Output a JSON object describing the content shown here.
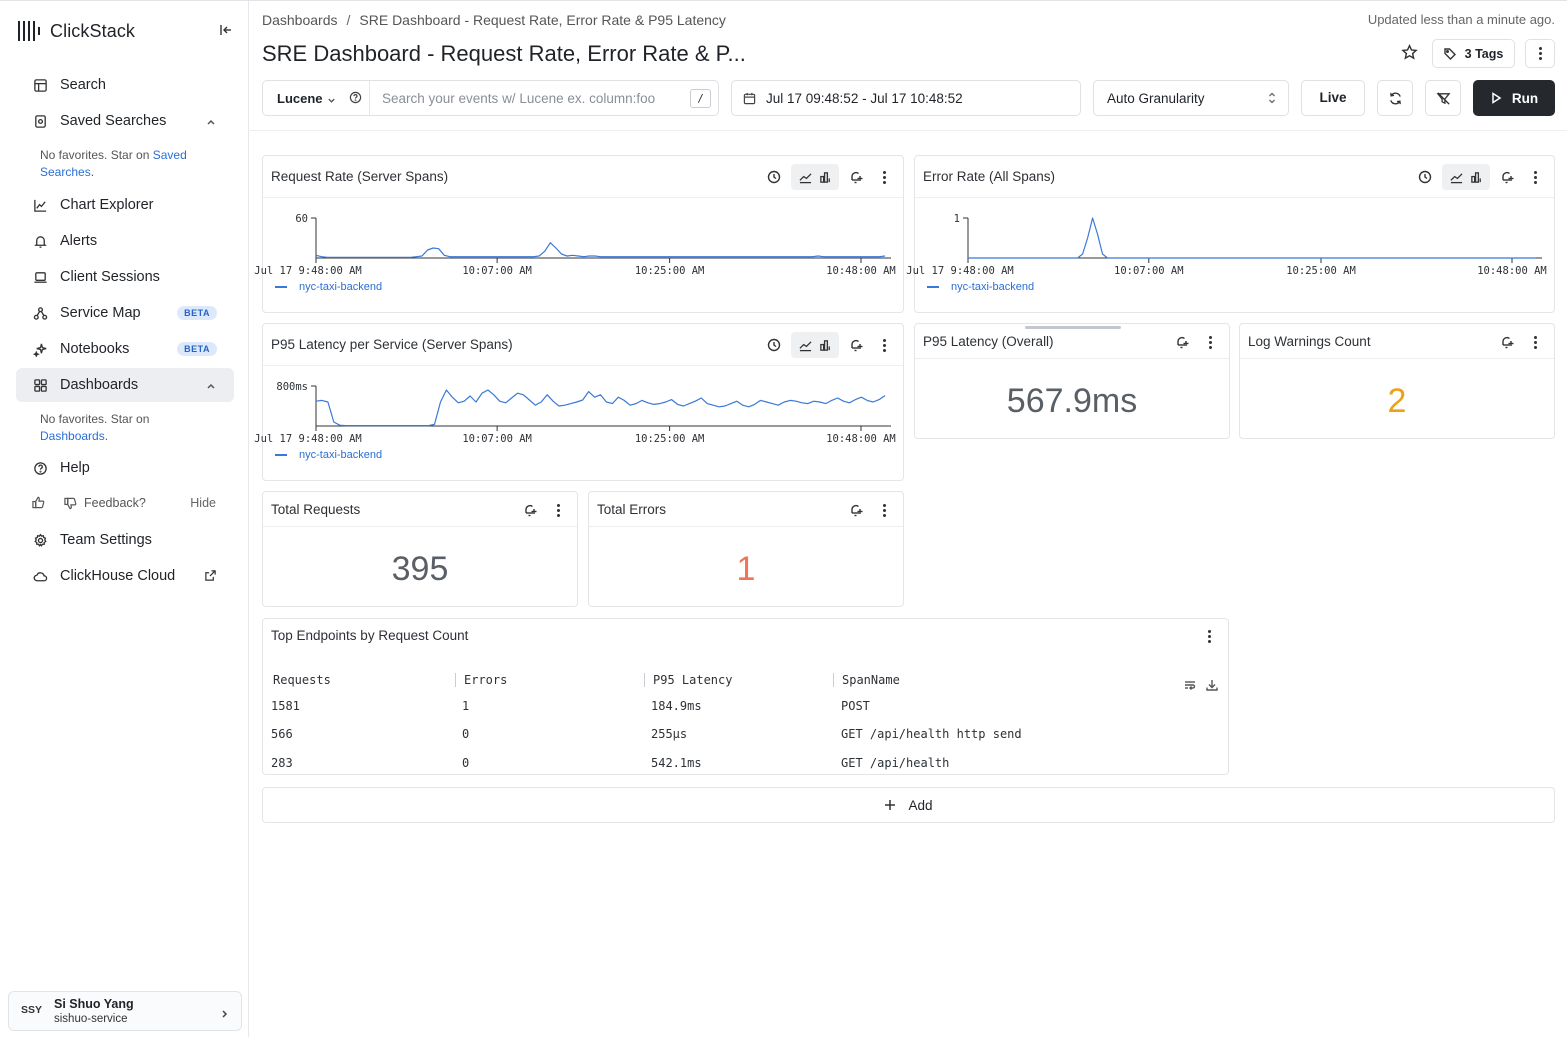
{
  "sidebar": {
    "brand": "ClickStack",
    "items": {
      "search": "Search",
      "saved_searches": "Saved Searches",
      "chart_explorer": "Chart Explorer",
      "alerts": "Alerts",
      "client_sessions": "Client Sessions",
      "service_map": "Service Map",
      "notebooks": "Notebooks",
      "dashboards": "Dashboards",
      "help": "Help",
      "team_settings": "Team Settings",
      "clickhouse_cloud": "ClickHouse Cloud"
    },
    "beta_label": "BETA",
    "saved_note_prefix": "No favorites. Star on",
    "saved_note_link": "Saved Searches",
    "saved_note_suffix": ".",
    "dash_note_prefix": "No favorites. Star on",
    "dash_note_link": "Dashboards",
    "dash_note_suffix": ".",
    "feedback": "Feedback?",
    "hide": "Hide",
    "user": {
      "initials": "SSY",
      "name": "Si Shuo Yang",
      "service": "sishuo-service"
    }
  },
  "header": {
    "breadcrumb_root": "Dashboards",
    "breadcrumb_sep": "/",
    "breadcrumb_current": "SRE Dashboard - Request Rate, Error Rate & P95 Latency",
    "updated": "Updated less than a minute ago.",
    "title": "SRE Dashboard - Request Rate, Error Rate & P...",
    "tags_label": "3 Tags"
  },
  "toolbar": {
    "language": "Lucene",
    "query_value": "",
    "query_placeholder": "Search your events w/ Lucene ex. column:foo",
    "slash_key": "/",
    "date_range": "Jul 17 09:48:52 - Jul 17 10:48:52",
    "granularity": "Auto Granularity",
    "live_label": "Live",
    "run_label": "Run"
  },
  "tiles": {
    "request_rate": {
      "title": "Request Rate (Server Spans)",
      "legend": "nyc-taxi-backend"
    },
    "error_rate": {
      "title": "Error Rate (All Spans)",
      "legend": "nyc-taxi-backend"
    },
    "p95_service": {
      "title": "P95 Latency per Service (Server Spans)",
      "legend": "nyc-taxi-backend"
    },
    "p95_overall": {
      "title": "P95 Latency (Overall)",
      "value": "567.9ms"
    },
    "log_warnings": {
      "title": "Log Warnings Count",
      "value": "2",
      "color": "#eaa21a"
    },
    "total_requests": {
      "title": "Total Requests",
      "value": "395"
    },
    "total_errors": {
      "title": "Total Errors",
      "value": "1",
      "color": "#f0735a"
    },
    "top_endpoints": {
      "title": "Top Endpoints by Request Count",
      "columns": [
        "Requests",
        "Errors",
        "P95 Latency",
        "SpanName"
      ],
      "rows": [
        [
          "1581",
          "1",
          "184.9ms",
          "POST"
        ],
        [
          "566",
          "0",
          "255µs",
          "GET /api/health http send"
        ],
        [
          "283",
          "0",
          "542.1ms",
          "GET /api/health"
        ]
      ]
    }
  },
  "add_label": "Add",
  "chart_data": [
    {
      "type": "line",
      "name": "request_rate",
      "y_tick": "60",
      "ylim": [
        0,
        60
      ],
      "x_ticks": [
        "Jul 17 9:48:00 AM",
        "10:07:00 AM",
        "10:25:00 AM",
        "10:48:00 AM"
      ],
      "series": [
        {
          "name": "nyc-taxi-backend",
          "color": "#3b78d8",
          "values": [
            4,
            2,
            1,
            1,
            1,
            1,
            1,
            1,
            1,
            1,
            1,
            1,
            1,
            1,
            1,
            1,
            1,
            1,
            2,
            3,
            12,
            15,
            14,
            4,
            2,
            2,
            2,
            2,
            2,
            2,
            2,
            2,
            2,
            2,
            2,
            2,
            2,
            2,
            2,
            2,
            3,
            10,
            23,
            15,
            6,
            3,
            4,
            3,
            2,
            3,
            3,
            2,
            2,
            2,
            2,
            2,
            2,
            2,
            2,
            2,
            2,
            2,
            2,
            2,
            2,
            2,
            2,
            2,
            2,
            2,
            2,
            2,
            2,
            2,
            2,
            2,
            2,
            2,
            2,
            2,
            2,
            2,
            2,
            2,
            2,
            2,
            2,
            2,
            2,
            2,
            3,
            2,
            2,
            2,
            2,
            2,
            2,
            2,
            2,
            2,
            2,
            2,
            3
          ]
        }
      ]
    },
    {
      "type": "line",
      "name": "error_rate",
      "y_tick": "1",
      "ylim": [
        0,
        1
      ],
      "x_ticks": [
        "Jul 17 9:48:00 AM",
        "10:07:00 AM",
        "10:25:00 AM",
        "10:48:00 AM"
      ],
      "series": [
        {
          "name": "nyc-taxi-backend",
          "color": "#3b78d8",
          "values": [
            0,
            0,
            0,
            0,
            0,
            0,
            0,
            0,
            0,
            0,
            0,
            0,
            0,
            0,
            0,
            0,
            0,
            0,
            0,
            0,
            0,
            0,
            0,
            0.1,
            0.5,
            1,
            0.6,
            0.1,
            0,
            0,
            0,
            0,
            0,
            0,
            0,
            0,
            0,
            0,
            0,
            0,
            0,
            0,
            0,
            0,
            0,
            0,
            0,
            0,
            0,
            0,
            0,
            0,
            0,
            0,
            0,
            0,
            0,
            0,
            0,
            0,
            0,
            0,
            0,
            0,
            0,
            0,
            0,
            0,
            0,
            0,
            0,
            0,
            0,
            0,
            0,
            0,
            0,
            0,
            0,
            0,
            0,
            0,
            0,
            0,
            0,
            0,
            0,
            0,
            0,
            0,
            0,
            0,
            0,
            0,
            0,
            0,
            0,
            0,
            0,
            0,
            0,
            0,
            0,
            0,
            0,
            0,
            0,
            0,
            0,
            0,
            0,
            0,
            0,
            0,
            0
          ]
        }
      ]
    },
    {
      "type": "line",
      "name": "p95_service",
      "y_tick": "800ms",
      "ylim": [
        0,
        1000
      ],
      "x_ticks": [
        "Jul 17 9:48:00 AM",
        "10:07:00 AM",
        "10:25:00 AM",
        "10:48:00 AM"
      ],
      "series": [
        {
          "name": "nyc-taxi-backend",
          "color": "#3b78d8",
          "values": [
            620,
            640,
            600,
            100,
            20,
            10,
            10,
            10,
            10,
            10,
            10,
            10,
            10,
            10,
            10,
            10,
            10,
            10,
            10,
            10,
            40,
            600,
            900,
            720,
            580,
            620,
            750,
            600,
            820,
            900,
            780,
            620,
            580,
            700,
            820,
            780,
            650,
            520,
            600,
            780,
            620,
            500,
            520,
            560,
            600,
            650,
            860,
            720,
            780,
            600,
            560,
            720,
            640,
            520,
            560,
            640,
            580,
            540,
            560,
            600,
            660,
            540,
            500,
            560,
            620,
            700,
            560,
            520,
            480,
            500,
            560,
            620,
            520,
            480,
            540,
            640,
            600,
            560,
            520,
            600,
            640,
            620,
            580,
            560,
            620,
            600,
            560,
            640,
            700,
            620,
            580,
            660,
            720,
            640,
            600,
            660,
            760
          ]
        }
      ]
    }
  ]
}
